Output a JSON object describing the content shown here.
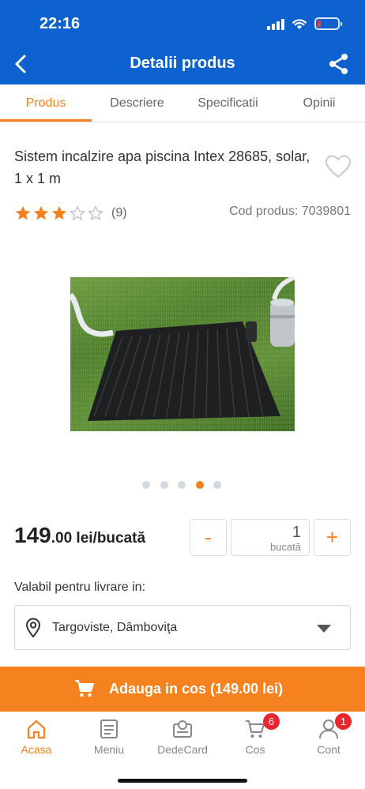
{
  "status_bar": {
    "time": "22:16"
  },
  "header": {
    "title": "Detalii produs"
  },
  "tabs": [
    {
      "label": "Produs",
      "active": true
    },
    {
      "label": "Descriere",
      "active": false
    },
    {
      "label": "Specificatii",
      "active": false
    },
    {
      "label": "Opinii",
      "active": false
    }
  ],
  "product": {
    "title": "Sistem incalzire apa piscina Intex 28685, solar, 1 x 1 m",
    "rating_stars": 3,
    "rating_max": 5,
    "rating_count": "(9)",
    "code": "Cod produs: 7039801",
    "image_count": 5,
    "active_image_index": 3
  },
  "price": {
    "main": "149",
    "rest": ".00 lei/bucată"
  },
  "quantity": {
    "minus": "-",
    "value": "1",
    "unit": "bucată",
    "plus": "+"
  },
  "delivery": {
    "label": "Valabil pentru livrare in:",
    "location": "Targoviste, Dâmboviţa"
  },
  "add_to_cart": {
    "label": "Adauga in cos (149.00 lei)"
  },
  "bottom_nav": {
    "items": [
      {
        "label": "Acasa",
        "icon": "home-icon",
        "active": true
      },
      {
        "label": "Meniu",
        "icon": "menu-list-icon",
        "active": false
      },
      {
        "label": "DedeCard",
        "icon": "card-icon",
        "active": false
      },
      {
        "label": "Cos",
        "icon": "cart-icon",
        "active": false,
        "badge": "6"
      },
      {
        "label": "Cont",
        "icon": "user-icon",
        "active": false,
        "badge": "1"
      }
    ]
  },
  "colors": {
    "header_blue": "#0e62cf",
    "accent_orange": "#f5821f",
    "badge_red": "#e8262d"
  }
}
